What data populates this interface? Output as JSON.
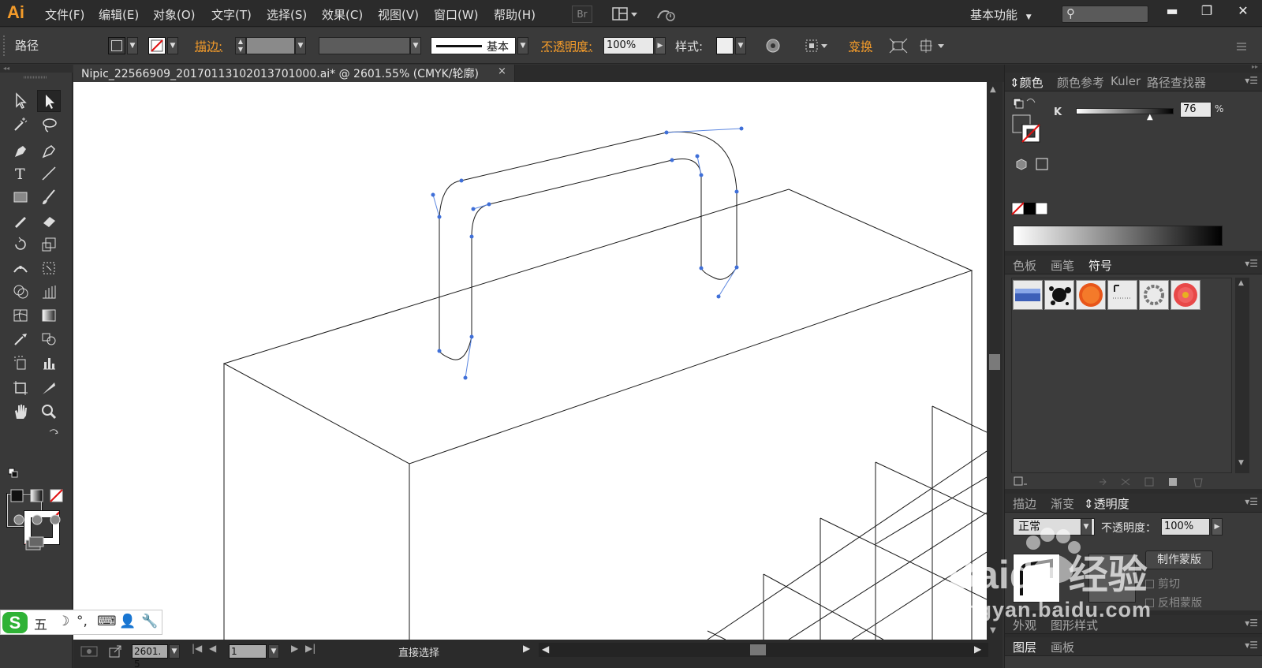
{
  "app": {
    "logo": "Ai",
    "accent": "#f39b2a"
  },
  "menubar": {
    "items": [
      "文件(F)",
      "编辑(E)",
      "对象(O)",
      "文字(T)",
      "选择(S)",
      "效果(C)",
      "视图(V)",
      "窗口(W)",
      "帮助(H)"
    ],
    "bridge_label": "Br",
    "workspace": "基本功能",
    "window_controls": {
      "minimize": "▬",
      "restore": "❐",
      "close": "✕"
    },
    "search_icon": "magnifier-icon"
  },
  "controlbar": {
    "selection_label": "路径",
    "stroke_link": "描边",
    "stroke_colon": ":",
    "brush_profile": "基本",
    "opacity_link": "不透明度",
    "opacity_colon": ":",
    "opacity_value": "100%",
    "style_label": "样式",
    "style_colon": ":",
    "transform_link": "变换"
  },
  "document": {
    "tab_title": "Nipic_22566909_20170113102013701000.ai* @ 2601.55% (CMYK/轮廓)",
    "close_glyph": "×"
  },
  "statusbar": {
    "zoom": "2601. 5",
    "page": "1",
    "tool_status": "直接选择"
  },
  "ime": {
    "logo": "S",
    "items": [
      "五",
      "☽",
      "°,",
      "⌨",
      "👤",
      "🔧"
    ]
  },
  "panels": {
    "color": {
      "tabs": [
        "颜色",
        "颜色参考",
        "Kuler",
        "路径查找器"
      ],
      "active_tab": "颜色",
      "channel_label": "K",
      "channel_value": "76",
      "percent": "%"
    },
    "symbols": {
      "tabs": [
        "色板",
        "画笔",
        "符号"
      ],
      "active_tab": "符号"
    },
    "transparency": {
      "tabs": [
        "描边",
        "渐变",
        "透明度"
      ],
      "active_tab": "透明度",
      "blend_mode": "正常",
      "opacity_label": "不透明度：",
      "opacity_value": "100%",
      "make_mask": "制作蒙版",
      "clip": "剪切",
      "invert_mask": "反相蒙版"
    },
    "appearance": {
      "tabs": [
        "外观",
        "图形样式"
      ]
    },
    "layers": {
      "tabs": [
        "图层",
        "画板"
      ]
    }
  },
  "watermark": {
    "brand": "Baidu 经验",
    "url": "jingyan.baidu.com"
  }
}
